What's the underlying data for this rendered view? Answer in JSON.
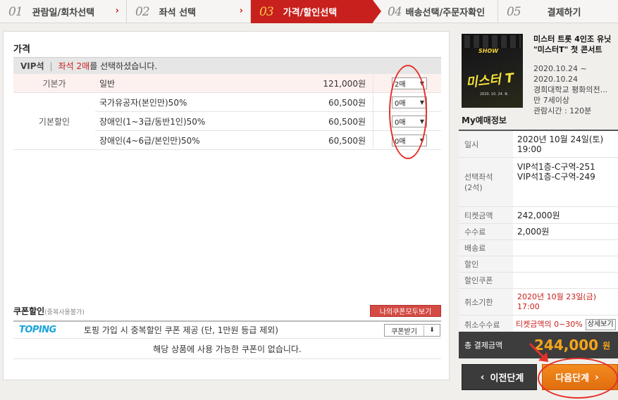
{
  "steps": [
    {
      "num": "01",
      "label": "관람일/회차선택"
    },
    {
      "num": "02",
      "label": "좌석 선택"
    },
    {
      "num": "03",
      "label": "가격/할인선택"
    },
    {
      "num": "04",
      "label": "배송선택/주문자확인"
    },
    {
      "num": "05",
      "label": "결제하기"
    }
  ],
  "price": {
    "section_title": "가격",
    "grade": "VIP석",
    "seat_msg_red": "좌석 2매",
    "seat_msg_rest": "를 선택하셨습니다.",
    "base": {
      "category": "기본가",
      "name": "일반",
      "price": "121,000원",
      "qty": "2매"
    },
    "discount_category": "기본할인",
    "discounts": [
      {
        "name": "국가유공자(본인만)50%",
        "price": "60,500원",
        "qty": "0매"
      },
      {
        "name": "장애인(1~3급/동반1인)50%",
        "price": "60,500원",
        "qty": "0매"
      },
      {
        "name": "장애인(4~6급/본인만)50%",
        "price": "60,500원",
        "qty": "0매"
      }
    ]
  },
  "coupon": {
    "title": "쿠폰할인",
    "subtitle": "(중복사용불가)",
    "my_coupons_btn": "나의쿠폰모두보기",
    "brand": "TOPING",
    "desc": "토핑 가입 시 중복할인 쿠폰 제공 (단, 1만원 등급 제외)",
    "get_btn": "쿠폰받기",
    "empty_msg": "해당 상품에 사용 가능한 쿠폰이 없습니다."
  },
  "show": {
    "title_line1": "미스터 트롯 4인조 유닛",
    "title_line2": "\"미스터T\" 첫 콘서트",
    "poster_show": "SHOW",
    "poster_title": "미스터 T",
    "poster_date": "2020. 10. 24. 토",
    "date_line1": "2020.10.24 ~",
    "date_line2": "2020.10.24",
    "venue": "경희대학교 평화의전...",
    "age": "만 7세이상",
    "runtime": "관람시간 : 120분"
  },
  "my_booking": {
    "title": "My예매정보",
    "date_label": "일시",
    "date_value_line1": "2020년 10월 24일(토)",
    "date_value_line2": "19:00",
    "seat_label_line1": "선택좌석",
    "seat_label_line2": "(2석)",
    "seat1": "VIP석1층-C구역-251",
    "seat2": "VIP석1층-C구역-249",
    "ticket_label": "티켓금액",
    "ticket_value": "242,000원",
    "fee_label": "수수료",
    "fee_value": "2,000원",
    "delivery_label": "배송료",
    "discount_label": "할인",
    "coupon_label": "할인쿠폰",
    "cancel_deadline_label": "취소기한",
    "cancel_deadline_line1": "2020년 10월 23일(금)",
    "cancel_deadline_line2": "17:00",
    "cancel_fee_label": "취소수수료",
    "cancel_fee_value": "티켓금액의 0~30%",
    "detail_btn": "상세보기",
    "total_label": "총 결제금액",
    "total_value": "244,000",
    "total_unit": "원"
  },
  "nav": {
    "prev": "이전단계",
    "next": "다음단계"
  },
  "colors": {
    "accent_red": "#c8201c",
    "next_orange": "#f38b1e",
    "total_amount": "#f5a51b"
  }
}
